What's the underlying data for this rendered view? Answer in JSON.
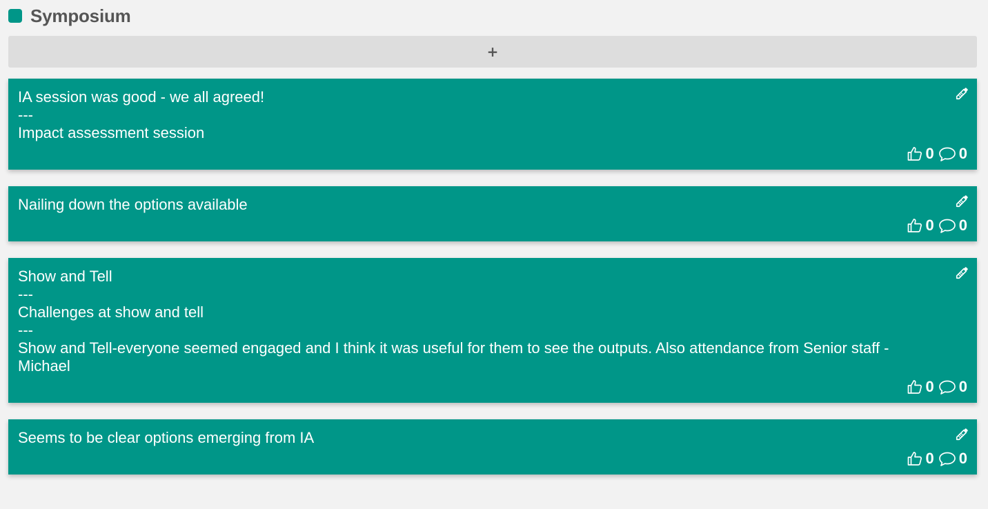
{
  "column": {
    "title": "Symposium",
    "color": "#009688",
    "add_label": "+"
  },
  "cards": [
    {
      "text": "IA session was good - we all agreed!\n---\nImpact assessment session",
      "likes": "0",
      "comments": "0",
      "icons": [
        "pencil-icon",
        "thumbs-up-icon",
        "comment-icon"
      ]
    },
    {
      "text": "Nailing down the options available",
      "likes": "0",
      "comments": "0",
      "icons": [
        "pencil-icon",
        "thumbs-up-icon",
        "comment-icon"
      ]
    },
    {
      "text": "Show and Tell\n---\nChallenges at show and tell\n---\nShow and Tell-everyone seemed engaged and I think it was useful for them to see the outputs. Also attendance from Senior staff - Michael",
      "likes": "0",
      "comments": "0",
      "icons": [
        "pencil-icon",
        "thumbs-up-icon",
        "comment-icon"
      ]
    },
    {
      "text": "Seems to be clear options emerging from IA",
      "likes": "0",
      "comments": "0",
      "icons": [
        "pencil-icon",
        "thumbs-up-icon",
        "comment-icon"
      ]
    }
  ],
  "colors": {
    "card_background": "#009688",
    "page_background": "#f2f2f2",
    "add_button_background": "#dddddd",
    "title_text": "#555555"
  }
}
